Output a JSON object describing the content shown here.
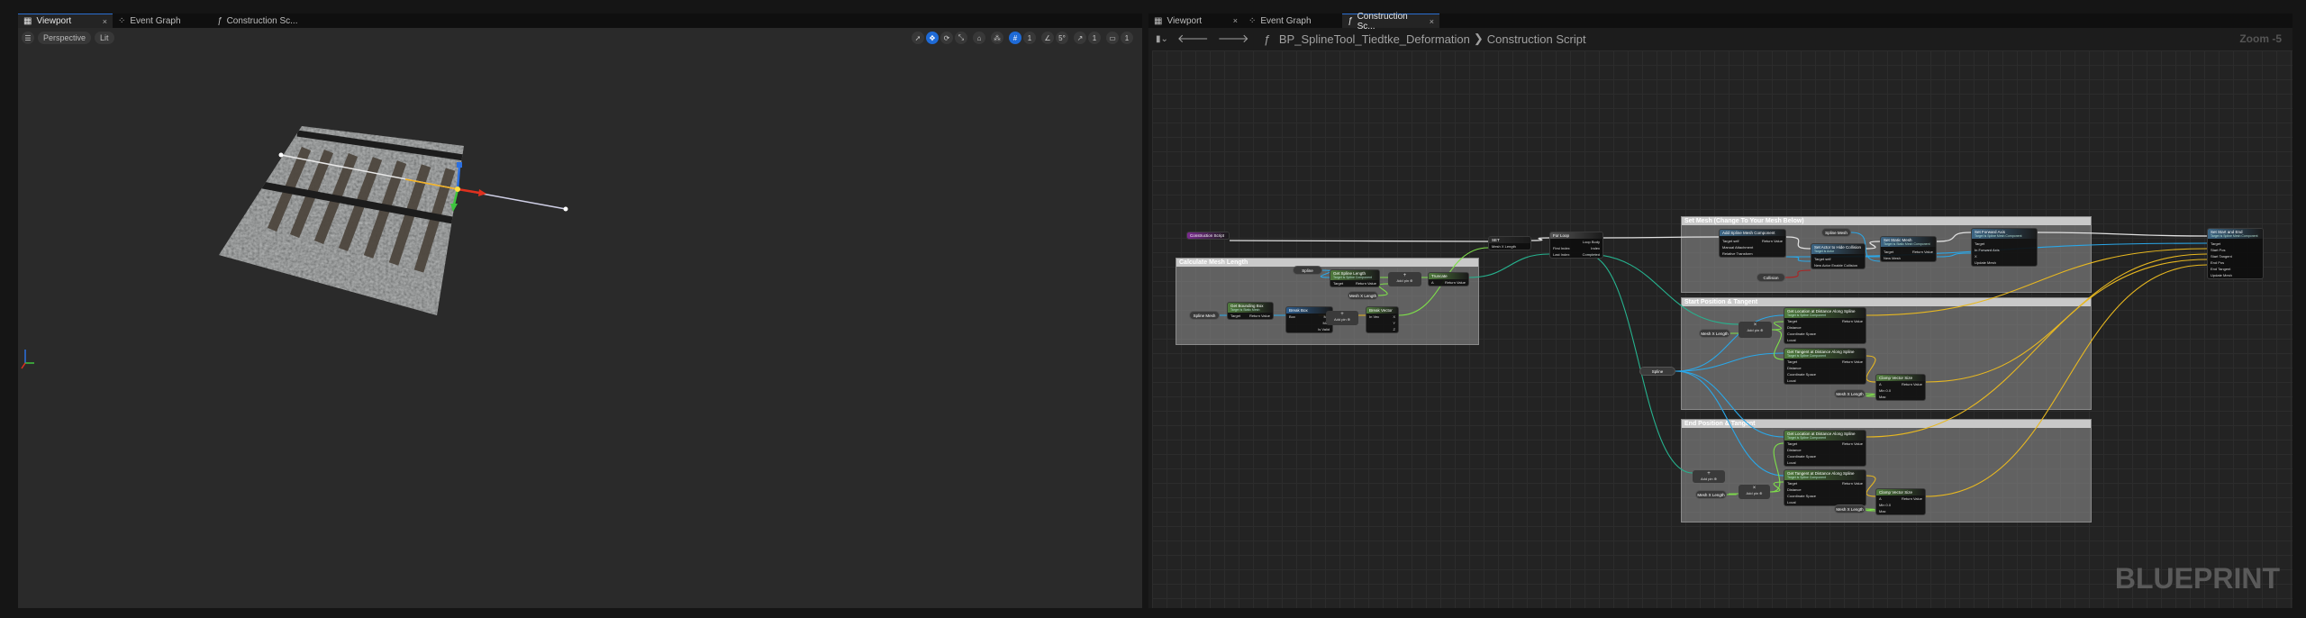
{
  "left_panel": {
    "tabs": [
      {
        "label": "Viewport",
        "icon": "viewport-icon",
        "active": true,
        "close": "×"
      },
      {
        "label": "Event Graph",
        "icon": "event-graph-icon"
      },
      {
        "label": "Construction Sc...",
        "icon": "function-icon"
      }
    ],
    "toolbar": {
      "menu_icon": "☰",
      "view_mode": "Perspective",
      "lighting": "Lit",
      "grid_snap": "1",
      "rotation_snap": "5°",
      "scale_snap": "1",
      "camera_speed": "1"
    }
  },
  "right_panel": {
    "tabs": [
      {
        "label": "Viewport",
        "icon": "viewport-icon",
        "close": "×"
      },
      {
        "label": "Event Graph",
        "icon": "event-graph-icon"
      },
      {
        "label": "Construction Sc...",
        "icon": "function-icon",
        "active": true,
        "close": "×"
      }
    ],
    "breadcrumb": {
      "blueprint": "BP_SplineTool_Tiedtke_Deformation",
      "separator": "❯",
      "graph": "Construction Script"
    },
    "zoom": "Zoom -5",
    "watermark": "BLUEPRINT"
  },
  "comments": [
    {
      "id": "c1",
      "title": "Calculate Mesh Length"
    },
    {
      "id": "c2",
      "title": "Set Mesh (Change To Your Mesh Below)"
    },
    {
      "id": "c3",
      "title": "Start Position & Tangent"
    },
    {
      "id": "c4",
      "title": "End Position & Tangent"
    }
  ],
  "nodes": [
    {
      "id": "cs",
      "title": "Construction Script",
      "color": "#7a2b8f",
      "pins": []
    },
    {
      "id": "set",
      "title": "SET",
      "color": "#2c2c2c",
      "pins": [
        [
          "Mesh X Length",
          ""
        ]
      ]
    },
    {
      "id": "loop",
      "title": "For Loop",
      "color": "#555555",
      "pins": [
        [
          "",
          "Loop Body"
        ],
        [
          "First Index",
          "Index"
        ],
        [
          "Last Index",
          "Completed"
        ]
      ]
    },
    {
      "id": "gsl",
      "title": "Get Spline Length",
      "sub": "Target is Spline Component",
      "color": "#4f7a3c",
      "pins": [
        [
          "Target",
          "Return Value"
        ]
      ]
    },
    {
      "id": "trunc",
      "title": "Truncate",
      "color": "#4f7a3c",
      "pins": [
        [
          "A",
          "Return Value"
        ]
      ]
    },
    {
      "id": "gbb",
      "title": "Get Bounding Box",
      "sub": "Target is Static Mesh",
      "color": "#4f7a3c",
      "pins": [
        [
          "Target",
          "Return Value"
        ]
      ]
    },
    {
      "id": "bbox",
      "title": "Break Box",
      "color": "#2b5a8a",
      "pins": [
        [
          "Box",
          "Min"
        ],
        [
          "",
          "Max"
        ],
        [
          "",
          "Is Valid"
        ]
      ]
    },
    {
      "id": "bvec",
      "title": "Break Vector",
      "color": "#4f7a3c",
      "pins": [
        [
          "In Vec",
          "X"
        ],
        [
          "",
          "Y"
        ],
        [
          "",
          "Z"
        ]
      ]
    },
    {
      "id": "asm",
      "title": "Add Spline Mesh Component",
      "color": "#3d6685",
      "pins": [
        [
          "",
          ""
        ],
        [
          "Target self",
          "Return Value"
        ],
        [
          "Manual Attachment",
          ""
        ],
        [
          "Relative Transform",
          ""
        ]
      ]
    },
    {
      "id": "hide",
      "title": "Set Actor to Hide Collision",
      "sub": "Target is Actor",
      "color": "#3d6685",
      "pins": [
        [
          "",
          ""
        ],
        [
          "Target self",
          ""
        ],
        [
          "New Actor Enable Collision",
          ""
        ]
      ]
    },
    {
      "id": "ssm",
      "title": "Set Static Mesh",
      "sub": "Target is Static Mesh Component",
      "color": "#3d6685",
      "pins": [
        [
          "",
          ""
        ],
        [
          "Target",
          "Return Value"
        ],
        [
          "New Mesh",
          ""
        ]
      ]
    },
    {
      "id": "sfa",
      "title": "Set Forward Axis",
      "sub": "Target is Spline Mesh Component",
      "color": "#3d6685",
      "pins": [
        [
          "",
          ""
        ],
        [
          "Target",
          ""
        ],
        [
          "In Forward Axis",
          ""
        ],
        [
          "X",
          ""
        ],
        [
          "Update Mesh",
          ""
        ]
      ]
    },
    {
      "id": "sse",
      "title": "Set Start and End",
      "sub": "Target is Spline Mesh Component",
      "color": "#3d6685",
      "pins": [
        [
          "",
          ""
        ],
        [
          "Target",
          ""
        ],
        [
          "Start Pos",
          ""
        ],
        [
          "Start Tangent",
          ""
        ],
        [
          "End Pos",
          ""
        ],
        [
          "End Tangent",
          ""
        ],
        [
          "Update Mesh",
          ""
        ]
      ]
    },
    {
      "id": "gl1",
      "title": "Get Location at Distance Along Spline",
      "sub": "Target is Spline Component",
      "color": "#4f7a3c",
      "pins": [
        [
          "Target",
          "Return Value"
        ],
        [
          "Distance",
          ""
        ],
        [
          "Coordinate Space",
          ""
        ],
        [
          "Local",
          ""
        ]
      ]
    },
    {
      "id": "gt1",
      "title": "Get Tangent at Distance Along Spline",
      "sub": "Target is Spline Component",
      "color": "#4f7a3c",
      "pins": [
        [
          "Target",
          "Return Value"
        ],
        [
          "Distance",
          ""
        ],
        [
          "Coordinate Space",
          ""
        ],
        [
          "Local",
          ""
        ]
      ]
    },
    {
      "id": "cv1",
      "title": "Clamp Vector Size",
      "color": "#4f7a3c",
      "pins": [
        [
          "A",
          "Return Value"
        ],
        [
          "Min 0.0",
          ""
        ],
        [
          "Max",
          ""
        ]
      ]
    },
    {
      "id": "gl2",
      "title": "Get Location at Distance Along Spline",
      "sub": "Target is Spline Component",
      "color": "#4f7a3c",
      "pins": [
        [
          "Target",
          "Return Value"
        ],
        [
          "Distance",
          ""
        ],
        [
          "Coordinate Space",
          ""
        ],
        [
          "Local",
          ""
        ]
      ]
    },
    {
      "id": "gt2",
      "title": "Get Tangent at Distance Along Spline",
      "sub": "Target is Spline Component",
      "color": "#4f7a3c",
      "pins": [
        [
          "Target",
          "Return Value"
        ],
        [
          "Distance",
          ""
        ],
        [
          "Coordinate Space",
          ""
        ],
        [
          "Local",
          ""
        ]
      ]
    },
    {
      "id": "cv2",
      "title": "Clamp Vector Size",
      "color": "#4f7a3c",
      "pins": [
        [
          "A",
          "Return Value"
        ],
        [
          "Min 0.0",
          ""
        ],
        [
          "Max",
          ""
        ]
      ]
    }
  ],
  "math_nodes": [
    {
      "id": "add1",
      "symbol": "+",
      "label": "Add pin ⊕"
    },
    {
      "id": "add2",
      "symbol": "+",
      "label": "Add pin ⊕"
    },
    {
      "id": "mul1",
      "symbol": "×",
      "label": "Add pin ⊕"
    },
    {
      "id": "add3",
      "symbol": "+",
      "label": "Add pin ⊕"
    },
    {
      "id": "mul2",
      "symbol": "×",
      "label": "Add pin ⊕"
    }
  ],
  "variables": [
    {
      "id": "v1",
      "label": "Spline"
    },
    {
      "id": "v2",
      "label": "Mesh X Length"
    },
    {
      "id": "v3",
      "label": "Spline Mesh"
    },
    {
      "id": "v4",
      "label": "Spline Mesh"
    },
    {
      "id": "v5",
      "label": "Collision"
    },
    {
      "id": "v6",
      "label": "Spline"
    },
    {
      "id": "v7",
      "label": "Mesh X Length"
    },
    {
      "id": "v8",
      "label": "Mesh X Length"
    },
    {
      "id": "v9",
      "label": "Mesh X Length"
    },
    {
      "id": "v10",
      "label": "Mesh X Length"
    }
  ],
  "colors": {
    "exec": "#e0e0e0",
    "object": "#2aa7e8",
    "float": "#7ee04a",
    "int": "#26b38f",
    "vector": "#e8b820",
    "bool": "#b02020"
  }
}
